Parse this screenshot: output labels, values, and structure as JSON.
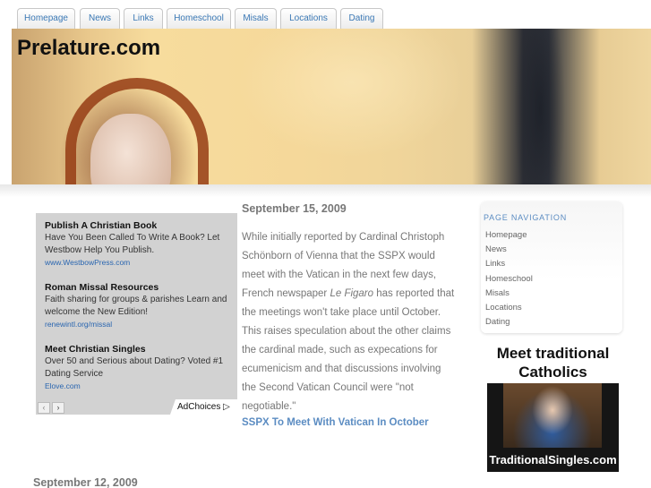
{
  "tabs": [
    "Homepage",
    "News",
    "Links",
    "Homeschool",
    "Misals",
    "Locations",
    "Dating"
  ],
  "site": {
    "title": "Prelature.com"
  },
  "ad": {
    "items": [
      {
        "title": "Publish A Christian Book",
        "text": "Have You Been Called To Write A Book? Let Westbow Help You Publish.",
        "url": "www.WestbowPress.com"
      },
      {
        "title": "Roman Missal Resources",
        "text": "Faith sharing for groups & parishes Learn and welcome the New Edition!",
        "url": "renewintl.org/missal"
      },
      {
        "title": "Meet Christian Singles",
        "text": "Over 50 and Serious about Dating? Voted #1 Dating Service",
        "url": "Elove.com"
      }
    ],
    "prev": "‹",
    "next": "›",
    "adchoices": "AdChoices ▷"
  },
  "post": {
    "date": "September 15, 2009",
    "text_before": "While initially reported by Cardinal Christoph Schönborn of Vienna that the SSPX would meet with the Vatican in the next few days, French newspaper ",
    "text_italic": "Le Figaro",
    "text_after": " has reported that the meetings won't take place until October. This raises speculation about the other claims the cardinal made, such as expecations for ecumenicism and that discussions involving the Second Vatican Council were \"not negotiable.\"",
    "link": "SSPX To Meet With Vatican In October"
  },
  "post2": {
    "date": "September 12, 2009"
  },
  "sidebar": {
    "title": "PAGE NAVIGATION",
    "items": [
      "Homepage",
      "News",
      "Links",
      "Homeschool",
      "Misals",
      "Locations",
      "Dating"
    ]
  },
  "banner": {
    "line1": "Meet traditional",
    "line2": "Catholics",
    "bottom": "TraditionalSingles.com"
  }
}
